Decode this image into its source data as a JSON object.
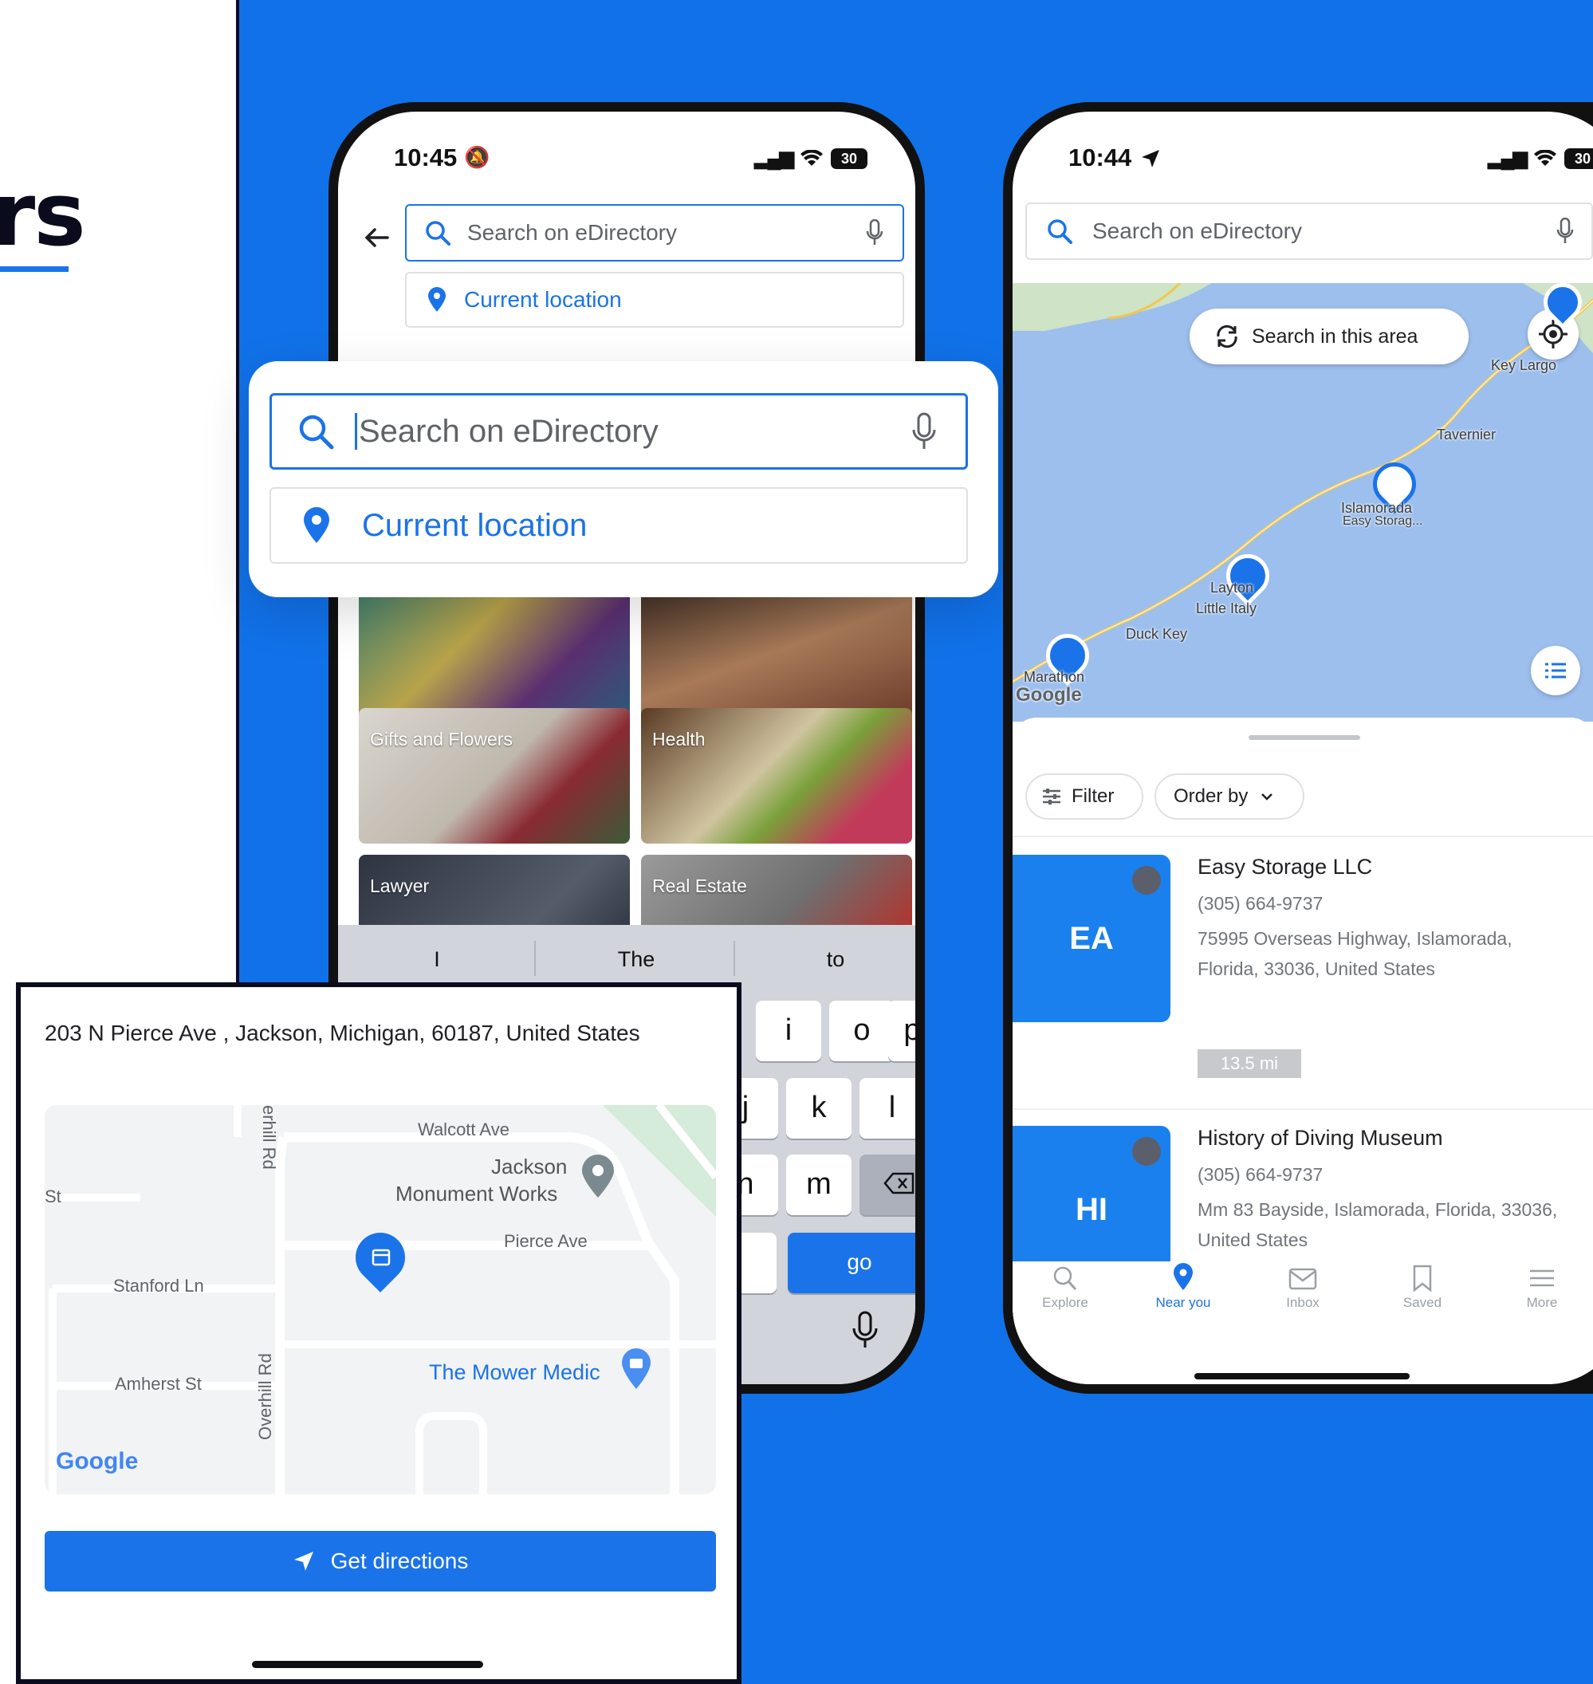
{
  "hero": {
    "fragment": "rs"
  },
  "phone1": {
    "status": {
      "time": "10:45",
      "battery": "30"
    },
    "search": {
      "placeholder": "Search on eDirectory",
      "location": "Current location"
    },
    "categories": [
      "Gifts and Flowers",
      "Health",
      "Lawyer",
      "Real Estate"
    ],
    "keyboard": {
      "suggestions": [
        "I",
        "The",
        "to"
      ],
      "row1": [
        "i",
        "o",
        "p"
      ],
      "row2": [
        "j",
        "k",
        "l"
      ],
      "row3": [
        "n",
        "m"
      ],
      "go": "go"
    }
  },
  "float_card": {
    "placeholder": "Search on eDirectory",
    "location": "Current location"
  },
  "phone2": {
    "status": {
      "time": "10:44",
      "battery": "30"
    },
    "search": {
      "placeholder": "Search on eDirectory"
    },
    "map": {
      "search_area_button": "Search in this area",
      "labels": [
        "Key Largo",
        "Tavernier",
        "Islamorada",
        "Easy Storag...",
        "Layton",
        "Little Italy",
        "Duck Key",
        "Marathon",
        "Google"
      ]
    },
    "filter_label": "Filter",
    "order_label": "Order by",
    "listings": [
      {
        "initials": "EA",
        "name": "Easy Storage LLC",
        "phone": "(305) 664-9737",
        "address": "75995 Overseas Highway, Islamorada, Florida, 33036, United States",
        "distance": "13.5 mi"
      },
      {
        "initials": "HI",
        "name": "History of Diving Museum",
        "phone": "(305) 664-9737",
        "address": "Mm 83 Bayside, Islamorada, Florida, 33036, United States"
      }
    ],
    "nav": [
      {
        "label": "Explore",
        "icon": "search-icon",
        "active": false
      },
      {
        "label": "Near you",
        "icon": "pin-icon",
        "active": true
      },
      {
        "label": "Inbox",
        "icon": "mail-icon",
        "active": false
      },
      {
        "label": "Saved",
        "icon": "bookmark-icon",
        "active": false
      },
      {
        "label": "More",
        "icon": "menu-icon",
        "active": false
      }
    ]
  },
  "directions_card": {
    "address": "203 N Pierce Ave , Jackson, Michigan, 60187, United States",
    "map_labels": {
      "walcott": "Walcott Ave",
      "jackson_monument_line1": "Jackson",
      "jackson_monument_line2": "Monument Works",
      "pierce": "Pierce Ave",
      "stanford": "Stanford Ln",
      "amherst": "Amherst St",
      "overhill": "Overhill Rd",
      "fairhill": "erhill Rd",
      "st": "St",
      "mower": "The Mower Medic",
      "google": "Google"
    },
    "button": "Get directions"
  },
  "colors": {
    "accent": "#1a73e8",
    "background_blue": "#1171e8",
    "thumb_blue": "#1a80ee"
  }
}
